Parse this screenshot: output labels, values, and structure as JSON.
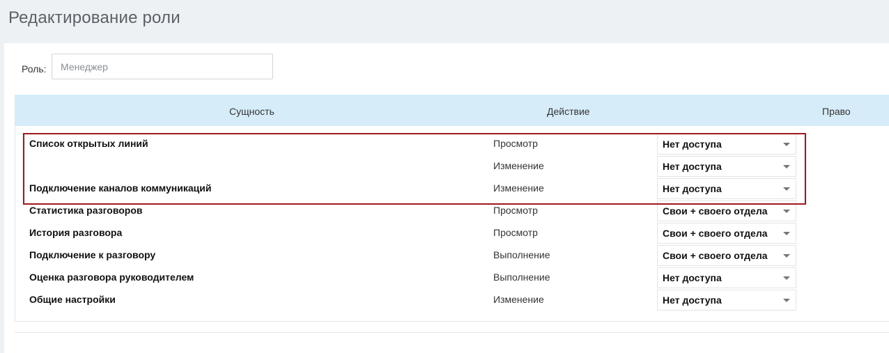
{
  "page": {
    "title": "Редактирование роли"
  },
  "role": {
    "label": "Роль:",
    "placeholder": "Менеджер",
    "value": ""
  },
  "table": {
    "headers": {
      "entity": "Сущность",
      "action": "Действие",
      "right": "Право"
    },
    "rows": [
      {
        "entity": "Список открытых линий",
        "action": "Просмотр",
        "right": "Нет доступа"
      },
      {
        "entity": "",
        "action": "Изменение",
        "right": "Нет доступа"
      },
      {
        "entity": "Подключение каналов коммуникаций",
        "action": "Изменение",
        "right": "Нет доступа"
      },
      {
        "entity": "Статистика разговоров",
        "action": "Просмотр",
        "right": "Свои + своего отдела"
      },
      {
        "entity": "История разговора",
        "action": "Просмотр",
        "right": "Свои + своего отдела"
      },
      {
        "entity": "Подключение к разговору",
        "action": "Выполнение",
        "right": "Свои + своего отдела"
      },
      {
        "entity": "Оценка разговора руководителем",
        "action": "Выполнение",
        "right": "Нет доступа"
      },
      {
        "entity": "Общие настройки",
        "action": "Изменение",
        "right": "Нет доступа"
      }
    ]
  },
  "colors": {
    "header_bg": "#d6edf9",
    "highlight": "#a0191e",
    "page_bg": "#eef1f4"
  },
  "icons": {
    "dropdown": "caret-down-icon"
  }
}
